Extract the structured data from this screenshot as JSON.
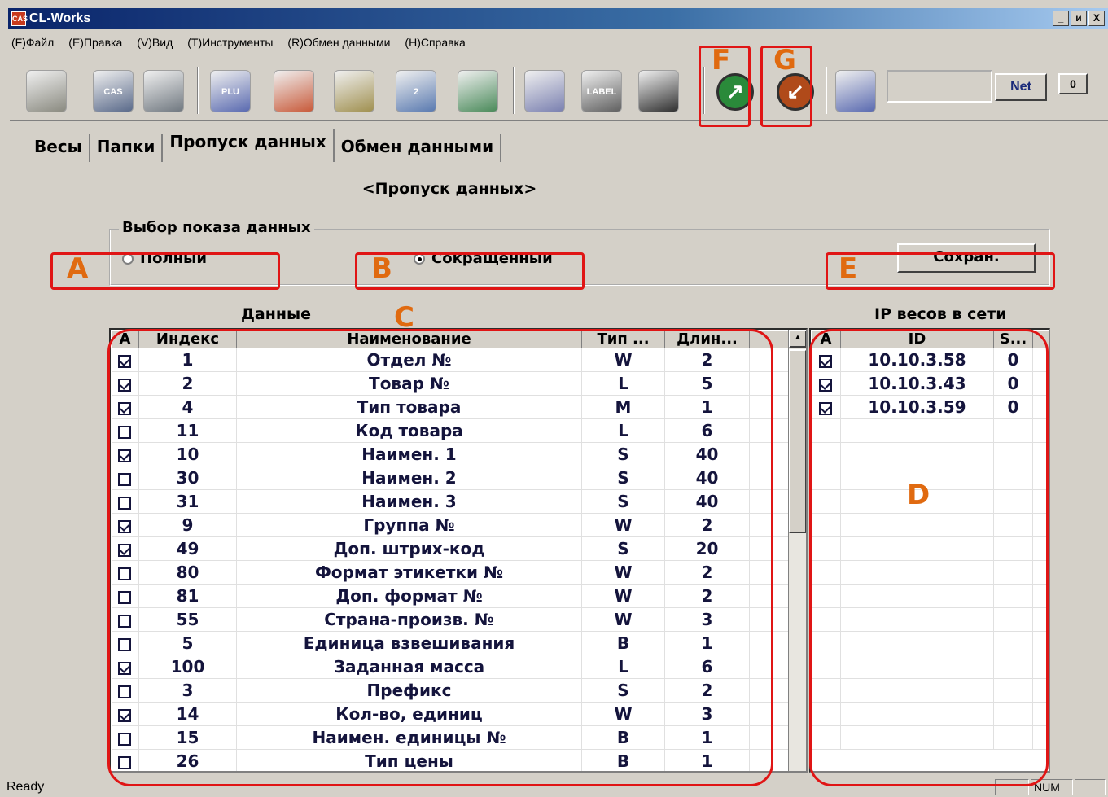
{
  "window": {
    "title": "CL-Works",
    "app_icon_text": "CAS",
    "controls": {
      "minimize": "_",
      "maximize": "и",
      "close": "X"
    }
  },
  "menu": [
    "(F)Файл",
    "(E)Правка",
    "(V)Вид",
    "(T)Инструменты",
    "(R)Обмен данными",
    "(H)Справка"
  ],
  "toolbar": {
    "buttons": [
      {
        "icon": "folder-icon",
        "color": "#8a8a80"
      },
      {
        "icon": "save-disk-icon",
        "color": "#5a6a8a",
        "text": "CAS"
      },
      {
        "icon": "printer-icon",
        "color": "#707880"
      },
      {
        "icon": "plu-icon",
        "color": "#5a6ab0",
        "text": "PLU"
      },
      {
        "icon": "star-icon",
        "color": "#c85a3a"
      },
      {
        "icon": "scale-data-icon",
        "color": "#a09050"
      },
      {
        "icon": "scale-2-icon",
        "color": "#5a7ab0",
        "text": "2"
      },
      {
        "icon": "network-people-icon",
        "color": "#4a8a5a"
      },
      {
        "icon": "list-data-icon",
        "color": "#7a80b0"
      },
      {
        "icon": "label-icon",
        "color": "#606060",
        "text": "LABEL"
      },
      {
        "icon": "keyboard-icon",
        "color": "#303030"
      },
      {
        "icon": "send-arrow-icon",
        "color": "#2a8a3a"
      },
      {
        "icon": "receive-arrow-icon",
        "color": "#b04a1a"
      },
      {
        "icon": "tools-icon",
        "color": "#5a6ab0"
      }
    ],
    "net_button_label": "Net",
    "net_count": "0"
  },
  "tabs": [
    "Весы",
    "Папки",
    "Пропуск данных",
    "Обмен данными"
  ],
  "active_tab": 2,
  "page_title": "<Пропуск данных>",
  "display_group": {
    "legend": "Выбор показа данных",
    "option_full": "Полный",
    "option_short": "Сокращённый",
    "selected": "short",
    "save_label": "Сохран."
  },
  "data_panel": {
    "title": "Данные",
    "columns": [
      "A",
      "Индекс",
      "Наименование",
      "Тип ...",
      "Длин..."
    ],
    "rows": [
      {
        "checked": true,
        "index": "1",
        "name": "Отдел №",
        "type": "W",
        "length": "2"
      },
      {
        "checked": true,
        "index": "2",
        "name": "Товар №",
        "type": "L",
        "length": "5"
      },
      {
        "checked": true,
        "index": "4",
        "name": "Тип товара",
        "type": "M",
        "length": "1"
      },
      {
        "checked": false,
        "index": "11",
        "name": "Код товара",
        "type": "L",
        "length": "6"
      },
      {
        "checked": true,
        "index": "10",
        "name": "Наимен. 1",
        "type": "S",
        "length": "40"
      },
      {
        "checked": false,
        "index": "30",
        "name": "Наимен. 2",
        "type": "S",
        "length": "40"
      },
      {
        "checked": false,
        "index": "31",
        "name": "Наимен. 3",
        "type": "S",
        "length": "40"
      },
      {
        "checked": true,
        "index": "9",
        "name": "Группа №",
        "type": "W",
        "length": "2"
      },
      {
        "checked": true,
        "index": "49",
        "name": "Доп. штрих-код",
        "type": "S",
        "length": "20"
      },
      {
        "checked": false,
        "index": "80",
        "name": "Формат этикетки №",
        "type": "W",
        "length": "2"
      },
      {
        "checked": false,
        "index": "81",
        "name": "Доп. формат №",
        "type": "W",
        "length": "2"
      },
      {
        "checked": false,
        "index": "55",
        "name": "Страна-произв. №",
        "type": "W",
        "length": "3"
      },
      {
        "checked": false,
        "index": "5",
        "name": "Единица взвешивания",
        "type": "B",
        "length": "1"
      },
      {
        "checked": true,
        "index": "100",
        "name": "Заданная масса",
        "type": "L",
        "length": "6"
      },
      {
        "checked": false,
        "index": "3",
        "name": "Префикс",
        "type": "S",
        "length": "2"
      },
      {
        "checked": true,
        "index": "14",
        "name": "Кол-во, единиц",
        "type": "W",
        "length": "3"
      },
      {
        "checked": false,
        "index": "15",
        "name": "Наимен. единицы №",
        "type": "B",
        "length": "1"
      },
      {
        "checked": false,
        "index": "26",
        "name": "Тип цены",
        "type": "B",
        "length": "1"
      }
    ],
    "scroll_up": "▲"
  },
  "ip_panel": {
    "title": "IP весов в сети",
    "columns": [
      "A",
      "ID",
      "S..."
    ],
    "rows": [
      {
        "checked": true,
        "id": "10.10.3.58",
        "s": "0"
      },
      {
        "checked": true,
        "id": "10.10.3.43",
        "s": "0"
      },
      {
        "checked": true,
        "id": "10.10.3.59",
        "s": "0"
      }
    ],
    "empty_rows": 14
  },
  "annotations": {
    "A": "A",
    "B": "B",
    "C": "C",
    "D": "D",
    "E": "E",
    "F": "F",
    "G": "G"
  },
  "status": {
    "text": "Ready",
    "num": "NUM"
  }
}
